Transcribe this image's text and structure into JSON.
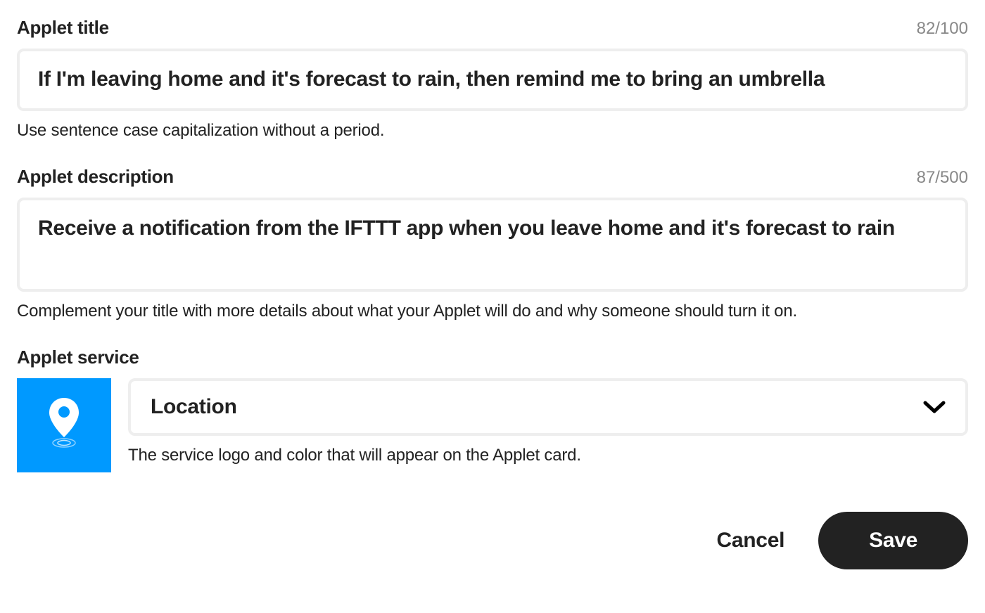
{
  "title_field": {
    "label": "Applet title",
    "char_count": "82/100",
    "value": "If I'm leaving home and it's forecast to rain, then remind me to bring an umbrella",
    "helper": "Use sentence case capitalization without a period."
  },
  "description_field": {
    "label": "Applet description",
    "char_count": "87/500",
    "value": "Receive a notification from the IFTTT app when you leave home and it's forecast to rain",
    "helper": "Complement your title with more details about what your Applet will do and why someone should turn it on."
  },
  "service_field": {
    "label": "Applet service",
    "selected": "Location",
    "helper": "The service logo and color that will appear on the Applet card.",
    "icon_color": "#0099ff"
  },
  "actions": {
    "cancel_label": "Cancel",
    "save_label": "Save"
  }
}
